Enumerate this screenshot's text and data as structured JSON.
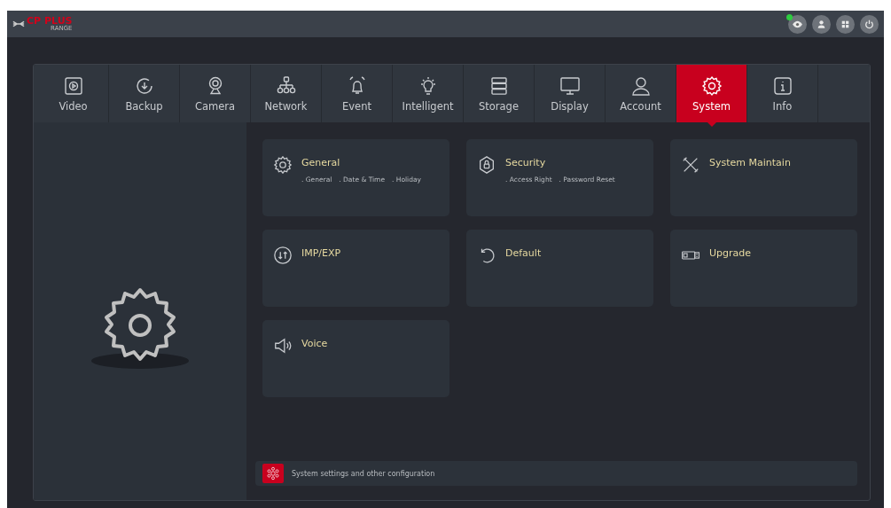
{
  "logo": {
    "brand": "CP PLUS",
    "sub": "RANGE"
  },
  "status_indicators": [
    {
      "on": true
    }
  ],
  "tabs": [
    {
      "label": "Video",
      "selected": false
    },
    {
      "label": "Backup",
      "selected": false
    },
    {
      "label": "Camera",
      "selected": false
    },
    {
      "label": "Network",
      "selected": false
    },
    {
      "label": "Event",
      "selected": false
    },
    {
      "label": "Intelligent",
      "selected": false
    },
    {
      "label": "Storage",
      "selected": false
    },
    {
      "label": "Display",
      "selected": false
    },
    {
      "label": "Account",
      "selected": false
    },
    {
      "label": "System",
      "selected": true
    },
    {
      "label": "Info",
      "selected": false
    }
  ],
  "cards": [
    {
      "title": "General",
      "links": [
        ". General",
        ". Date & Time",
        ". Holiday"
      ]
    },
    {
      "title": "Security",
      "links": [
        ". Access Right",
        ". Password Reset"
      ]
    },
    {
      "title": "System Maintain"
    },
    {
      "title": "IMP/EXP"
    },
    {
      "title": "Default"
    },
    {
      "title": "Upgrade"
    },
    {
      "title": "Voice"
    }
  ],
  "description": "System settings and other configuration"
}
